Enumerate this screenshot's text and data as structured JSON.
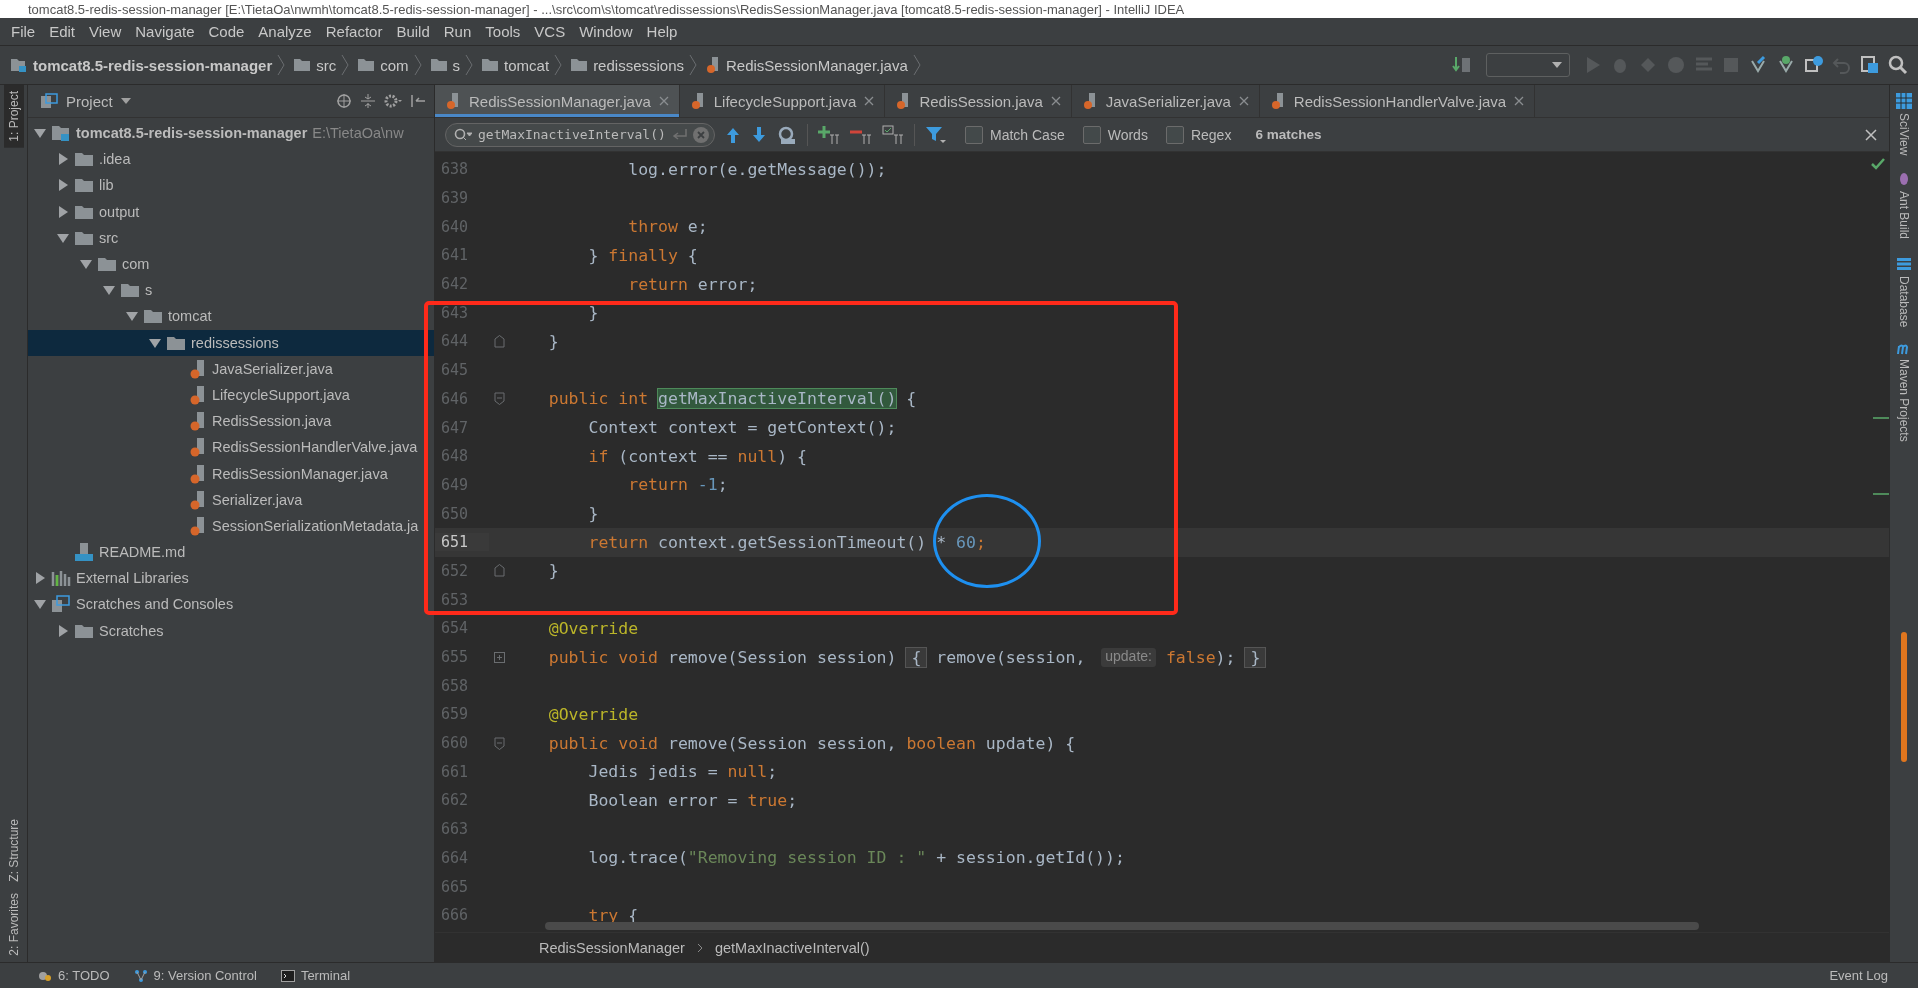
{
  "window": {
    "title": "tomcat8.5-redis-session-manager [E:\\TietaOa\\nwmh\\tomcat8.5-redis-session-manager] - ...\\src\\com\\s\\tomcat\\redissessions\\RedisSessionManager.java [tomcat8.5-redis-session-manager] - IntelliJ IDEA"
  },
  "menu": [
    "File",
    "Edit",
    "View",
    "Navigate",
    "Code",
    "Analyze",
    "Refactor",
    "Build",
    "Run",
    "Tools",
    "VCS",
    "Window",
    "Help"
  ],
  "navigation_bar": [
    {
      "label": "tomcat8.5-redis-session-manager",
      "kind": "module"
    },
    {
      "label": "src",
      "kind": "folder"
    },
    {
      "label": "com",
      "kind": "folder"
    },
    {
      "label": "s",
      "kind": "folder"
    },
    {
      "label": "tomcat",
      "kind": "folder"
    },
    {
      "label": "redissessions",
      "kind": "folder"
    },
    {
      "label": "RedisSessionManager.java",
      "kind": "java"
    }
  ],
  "left_stripe": [
    {
      "label": "1: Project",
      "selected": true
    },
    {
      "label": "Z: Structure",
      "selected": false
    },
    {
      "label": "2: Favorites",
      "selected": false
    }
  ],
  "right_stripe": [
    {
      "label": "SciView",
      "kind": "grid"
    },
    {
      "label": "Ant Build",
      "kind": "ant"
    },
    {
      "label": "Database",
      "kind": "database"
    },
    {
      "label": "Maven Projects",
      "kind": "maven"
    }
  ],
  "project_panel": {
    "title": "Project",
    "tree": [
      {
        "label": "tomcat8.5-redis-session-manager",
        "path": "E:\\TietaOa\\nw",
        "kind": "module",
        "expanded": true,
        "selected": false,
        "children": [
          {
            "label": ".idea",
            "kind": "folder",
            "expanded": false,
            "selected": false
          },
          {
            "label": "lib",
            "kind": "folder",
            "expanded": false,
            "selected": false
          },
          {
            "label": "output",
            "kind": "folder",
            "expanded": false,
            "selected": false
          },
          {
            "label": "src",
            "kind": "folder",
            "expanded": true,
            "selected": false,
            "children": [
              {
                "label": "com",
                "kind": "folder",
                "expanded": true,
                "selected": false,
                "children": [
                  {
                    "label": "s",
                    "kind": "folder",
                    "expanded": true,
                    "selected": false,
                    "children": [
                      {
                        "label": "tomcat",
                        "kind": "folder",
                        "expanded": true,
                        "selected": false,
                        "children": [
                          {
                            "label": "redissessions",
                            "kind": "folder",
                            "expanded": true,
                            "selected": true,
                            "children": [
                              {
                                "label": "JavaSerializer.java",
                                "kind": "java",
                                "selected": false
                              },
                              {
                                "label": "LifecycleSupport.java",
                                "kind": "java",
                                "selected": false
                              },
                              {
                                "label": "RedisSession.java",
                                "kind": "java",
                                "selected": false
                              },
                              {
                                "label": "RedisSessionHandlerValve.java",
                                "kind": "java",
                                "selected": false
                              },
                              {
                                "label": "RedisSessionManager.java",
                                "kind": "java",
                                "selected": false
                              },
                              {
                                "label": "Serializer.java",
                                "kind": "java",
                                "selected": false
                              },
                              {
                                "label": "SessionSerializationMetadata.ja",
                                "kind": "java",
                                "selected": false
                              }
                            ]
                          }
                        ]
                      }
                    ]
                  }
                ]
              }
            ]
          },
          {
            "label": "README.md",
            "kind": "markdown",
            "selected": false
          }
        ]
      },
      {
        "label": "External Libraries",
        "kind": "library",
        "expanded": false,
        "selected": false
      },
      {
        "label": "Scratches and Consoles",
        "kind": "scratches",
        "expanded": true,
        "selected": false,
        "children": [
          {
            "label": "Scratches",
            "kind": "folder",
            "expanded": false,
            "selected": false
          }
        ]
      }
    ]
  },
  "editor_tabs": [
    {
      "label": "RedisSessionManager.java",
      "selected": true
    },
    {
      "label": "LifecycleSupport.java",
      "selected": false
    },
    {
      "label": "RedisSession.java",
      "selected": false
    },
    {
      "label": "JavaSerializer.java",
      "selected": false
    },
    {
      "label": "RedisSessionHandlerValve.java",
      "selected": false
    }
  ],
  "search": {
    "value": "getMaxInactiveInterval()",
    "options": [
      {
        "label": "Match Case",
        "checked": false
      },
      {
        "label": "Words",
        "checked": false
      },
      {
        "label": "Regex",
        "checked": false
      }
    ],
    "result": "6 matches"
  },
  "code_lines": [
    {
      "number": "638",
      "current": false,
      "tokens": [
        {
          "kind": "plain",
          "text": "            log.error(e.getMessage());"
        }
      ]
    },
    {
      "number": "639",
      "current": false
    },
    {
      "number": "640",
      "current": false,
      "tokens": [
        {
          "kind": "keyword",
          "text": "            throw"
        },
        {
          "kind": "plain",
          "text": " e;"
        }
      ]
    },
    {
      "number": "641",
      "current": false,
      "tokens": [
        {
          "kind": "plain",
          "text": "        } "
        },
        {
          "kind": "keyword",
          "text": "finally"
        },
        {
          "kind": "plain",
          "text": " {"
        }
      ]
    },
    {
      "number": "642",
      "current": false,
      "tokens": [
        {
          "kind": "keyword",
          "text": "            return"
        },
        {
          "kind": "plain",
          "text": " error;"
        }
      ]
    },
    {
      "number": "643",
      "current": false,
      "tokens": [
        {
          "kind": "plain",
          "text": "        }"
        }
      ]
    },
    {
      "number": "644",
      "current": false,
      "fold_marker": {
        "kind": "end"
      },
      "tokens": [
        {
          "kind": "plain",
          "text": "    }"
        }
      ]
    },
    {
      "number": "645",
      "current": false
    },
    {
      "number": "646",
      "current": false,
      "fold_marker": {
        "kind": "start"
      },
      "tokens": [
        {
          "kind": "keyword",
          "text": "    public int "
        },
        {
          "kind": "match",
          "text": "getMaxInactiveInterval()"
        },
        {
          "kind": "plain",
          "text": " {"
        }
      ]
    },
    {
      "number": "647",
      "current": false,
      "tokens": [
        {
          "kind": "plain",
          "text": "        Context context = getContext();"
        }
      ]
    },
    {
      "number": "648",
      "current": false,
      "tokens": [
        {
          "kind": "keyword",
          "text": "        if"
        },
        {
          "kind": "plain",
          "text": " (context == "
        },
        {
          "kind": "keyword",
          "text": "null"
        },
        {
          "kind": "plain",
          "text": ") {"
        }
      ]
    },
    {
      "number": "649",
      "current": false,
      "tokens": [
        {
          "kind": "keyword",
          "text": "            return "
        },
        {
          "kind": "number",
          "text": "-1"
        },
        {
          "kind": "plain",
          "text": ";"
        }
      ]
    },
    {
      "number": "650",
      "current": false,
      "tokens": [
        {
          "kind": "plain",
          "text": "        }"
        }
      ]
    },
    {
      "number": "651",
      "current": true,
      "tokens": [
        {
          "kind": "keyword",
          "text": "        return"
        },
        {
          "kind": "plain",
          "text": " context.getSessionTimeout() * "
        },
        {
          "kind": "number",
          "text": "60"
        },
        {
          "kind": "keyword",
          "text": ";"
        }
      ]
    },
    {
      "number": "652",
      "current": false,
      "fold_marker": {
        "kind": "end"
      },
      "tokens": [
        {
          "kind": "plain",
          "text": "    }"
        }
      ]
    },
    {
      "number": "653",
      "current": false
    },
    {
      "number": "654",
      "current": false,
      "tokens": [
        {
          "kind": "annotation",
          "text": "    @Override"
        }
      ]
    },
    {
      "number": "655",
      "current": false,
      "fold_marker": {
        "kind": "collapsed"
      },
      "tokens": [
        {
          "kind": "keyword",
          "text": "    public void"
        },
        {
          "kind": "plain",
          "text": " remove(Session session) "
        },
        {
          "kind": "fold",
          "text": "{"
        },
        {
          "kind": "plain",
          "text": " remove(session, "
        },
        {
          "kind": "hint",
          "text": "update:"
        },
        {
          "kind": "keyword",
          "text": " false"
        },
        {
          "kind": "plain",
          "text": "); "
        },
        {
          "kind": "fold",
          "text": "}"
        }
      ]
    },
    {
      "number": "658",
      "current": false
    },
    {
      "number": "659",
      "current": false,
      "tokens": [
        {
          "kind": "annotation",
          "text": "    @Override"
        }
      ]
    },
    {
      "number": "660",
      "current": false,
      "fold_marker": {
        "kind": "start"
      },
      "tokens": [
        {
          "kind": "keyword",
          "text": "    public void"
        },
        {
          "kind": "plain",
          "text": " remove(Session session, "
        },
        {
          "kind": "keyword",
          "text": "boolean"
        },
        {
          "kind": "plain",
          "text": " update) {"
        }
      ]
    },
    {
      "number": "661",
      "current": false,
      "tokens": [
        {
          "kind": "plain",
          "text": "        Jedis jedis = "
        },
        {
          "kind": "keyword",
          "text": "null"
        },
        {
          "kind": "plain",
          "text": ";"
        }
      ]
    },
    {
      "number": "662",
      "current": false,
      "tokens": [
        {
          "kind": "plain",
          "text": "        Boolean error = "
        },
        {
          "kind": "keyword",
          "text": "true"
        },
        {
          "kind": "plain",
          "text": ";"
        }
      ]
    },
    {
      "number": "663",
      "current": false
    },
    {
      "number": "664",
      "current": false,
      "tokens": [
        {
          "kind": "plain",
          "text": "        log.trace("
        },
        {
          "kind": "string",
          "text": "\"Removing session ID : \""
        },
        {
          "kind": "plain",
          "text": " + session.getId());"
        }
      ]
    },
    {
      "number": "665",
      "current": false
    },
    {
      "number": "666",
      "current": false,
      "tokens": [
        {
          "kind": "keyword",
          "text": "        try"
        },
        {
          "kind": "plain",
          "text": " {"
        }
      ]
    }
  ],
  "breadcrumb": [
    "RedisSessionManager",
    "getMaxInactiveInterval()"
  ],
  "annotations": [
    {
      "kind": "rectangle",
      "color": "#ff2a1a"
    },
    {
      "kind": "ellipse",
      "color": "#1e90f0"
    }
  ],
  "status_bar": {
    "tools": [
      {
        "label": "6: TODO",
        "kind": "todo"
      },
      {
        "label": "9: Version Control",
        "kind": "vcs"
      },
      {
        "label": "Terminal",
        "kind": "terminal"
      }
    ],
    "event_log": "Event Log"
  }
}
